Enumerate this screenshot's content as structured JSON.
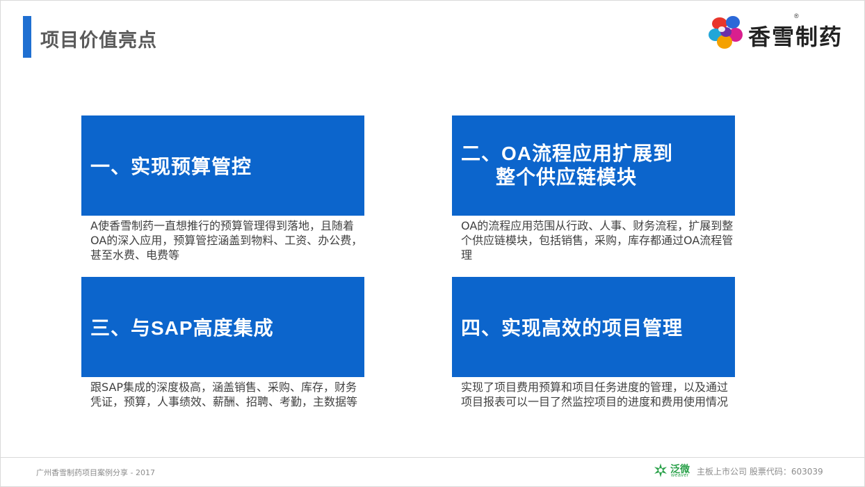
{
  "header": {
    "title": "项目价值亮点",
    "logo_text": "香雪制药",
    "logo_reg": "®"
  },
  "cards": [
    {
      "heading": "一、实现预算管控",
      "body": "A使香雪制药一直想推行的预算管理得到落地，且随着OA的深入应用，预算管控涵盖到物料、工资、办公费，甚至水费、电费等"
    },
    {
      "heading_line1": "二、OA流程应用扩展到",
      "heading_line2": "整个供应链模块",
      "body": "OA的流程应用范围从行政、人事、财务流程，扩展到整个供应链模块，包括销售，采购，库存都通过OA流程管理"
    },
    {
      "heading": "三、与SAP高度集成",
      "body": "跟SAP集成的深度极高，涵盖销售、采购、库存，财务凭证，预算，人事绩效、薪酬、招聘、考勤，主数据等"
    },
    {
      "heading": "四、实现高效的项目管理",
      "body": "实现了项目费用预算和项目任务进度的管理，以及通过项目报表可以一目了然监控项目的进度和费用使用情况"
    }
  ],
  "footer": {
    "left": "广州香雪制药项目案例分享 - 2017",
    "weaver_cn": "泛微",
    "weaver_en": "weaver",
    "right": "主板上市公司  股票代码：603039"
  },
  "colors": {
    "accent": "#1f6fd1",
    "card": "#0c65cc",
    "weaver_green": "#2aa14a"
  }
}
